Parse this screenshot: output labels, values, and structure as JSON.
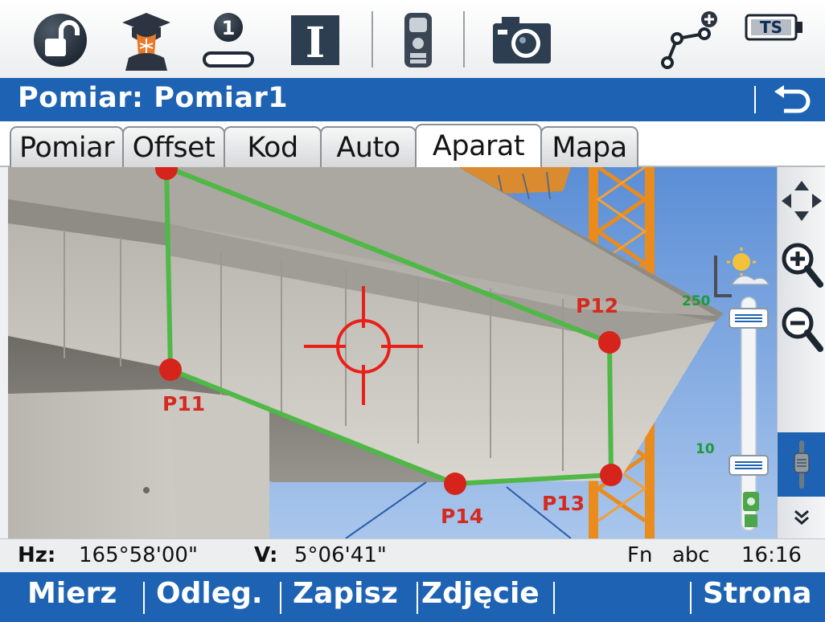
{
  "toolbar": {
    "icons": [
      "unlock-icon",
      "surveyor-profile-icon",
      "single-measurement-icon",
      "info-icon",
      "total-station-icon",
      "camera-icon",
      "add-line-icon",
      "battery-icon"
    ],
    "single_badge": "1",
    "info_letter": "I",
    "battery_text": "TS",
    "colors": {
      "icon_blue": "#1e63b3",
      "icon_dark": "#2d3e50",
      "accent_orange": "#e8782a"
    }
  },
  "title_bar": {
    "title": "Pomiar: Pomiar1",
    "back_icon": "back-arrow-icon"
  },
  "tabs": [
    {
      "label": "Pomiar",
      "active": false
    },
    {
      "label": "Offset",
      "active": false
    },
    {
      "label": "Kod",
      "active": false
    },
    {
      "label": "Auto",
      "active": false
    },
    {
      "label": "Aparat",
      "active": true
    },
    {
      "label": "Mapa",
      "active": false
    }
  ],
  "camera_view": {
    "points": [
      "P11",
      "P12",
      "P13",
      "P14"
    ],
    "crosshair_icon": "crosshair-icon",
    "polygon_color": "#52b848",
    "point_color": "#d6231c",
    "zoom_slider": {
      "max_label": "250",
      "min_label": "10",
      "upper_handle": 0.09,
      "lower_handle": 0.72
    }
  },
  "side_panel": {
    "buttons": [
      "pan-arrows-icon",
      "zoom-in-icon",
      "zoom-out-icon",
      "focus-slider-icon",
      "expand-down-icon"
    ]
  },
  "status_bar": {
    "hz_label": "Hz:",
    "hz_value": "165°58'00\"",
    "v_label": "V:",
    "v_value": "5°06'41\"",
    "fn": "Fn",
    "input_mode": "abc",
    "time": "16:16"
  },
  "softkeys": {
    "mierz": "Mierz",
    "odleg": "Odleg.",
    "zapisz": "Zapisz",
    "zdjecie": "Zdjęcie",
    "empty": "",
    "strona": "Strona"
  }
}
